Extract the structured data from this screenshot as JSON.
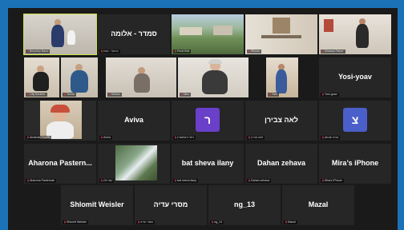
{
  "tiles": [
    {
      "label": "Beverley Band",
      "type": "video",
      "active": true
    },
    {
      "label": "כרמל י- זכות",
      "type": "name",
      "display": "סמדר - אלומה"
    },
    {
      "label": "Fredi Bell",
      "type": "video"
    },
    {
      "label": "iPhone",
      "type": "video"
    },
    {
      "label": "Mirassa Fisher",
      "type": "video"
    },
    {
      "label": "Lilly Berliner",
      "type": "video"
    },
    {
      "label": "Tamar",
      "type": "video"
    },
    {
      "label": "Miriam",
      "type": "video"
    },
    {
      "label": "Nira",
      "type": "video"
    },
    {
      "label": "Yael",
      "type": "video"
    },
    {
      "label": "Yosi-goav",
      "type": "name",
      "display": "Yosi-yoav"
    },
    {
      "label": "Amanda Fiorelli",
      "type": "video"
    },
    {
      "label": "Aviva",
      "type": "name",
      "display": "Aviva"
    },
    {
      "label": "רחל ביגלשטיין",
      "type": "avatar",
      "avatar": "ר",
      "avatar_color": "#6a3fc9"
    },
    {
      "label": "לאה צבירן",
      "type": "name",
      "display": "לאה צבירן"
    },
    {
      "label": "צביה קוטמן",
      "type": "avatar",
      "avatar": "צ",
      "avatar_color": "#4a5fc9"
    },
    {
      "label": "Aharona Pasternak",
      "type": "name",
      "display": "Aharona  Pastern..."
    },
    {
      "label": "עמי זלץ",
      "type": "video"
    },
    {
      "label": "bat sheva ilany",
      "type": "name",
      "display": "bat sheva ilany"
    },
    {
      "label": "Dahan zehava",
      "type": "name",
      "display": "Dahan zehava"
    },
    {
      "label": "Mira's iPhone",
      "type": "name",
      "display": "Mira’s iPhone"
    },
    {
      "label": "Shlomit Weisler",
      "type": "name",
      "display": "Shlomit Weisler"
    },
    {
      "label": "מסרי עדיה",
      "type": "name",
      "display": "מסרי עדיה"
    },
    {
      "label": "ng_13",
      "type": "name",
      "display": "ng_13"
    },
    {
      "label": "Mazal",
      "type": "name",
      "display": "Mazal"
    }
  ],
  "colors": {
    "frame": "#1c72b6",
    "tile": "#262626",
    "active_outline": "#c9e24a",
    "mic_muted": "#e0424a"
  }
}
